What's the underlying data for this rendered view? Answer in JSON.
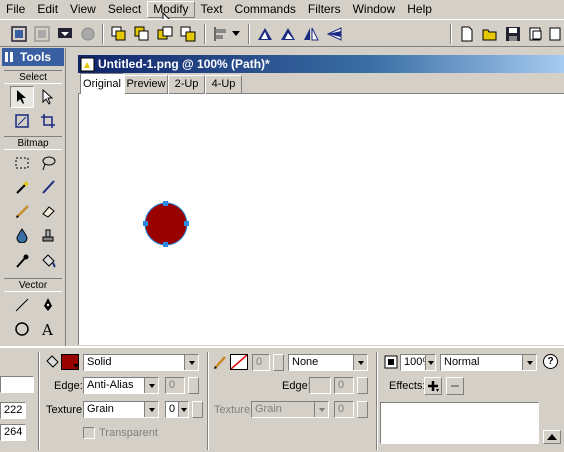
{
  "menubar": {
    "items": [
      {
        "label": "File",
        "active": false
      },
      {
        "label": "Edit",
        "active": false
      },
      {
        "label": "View",
        "active": false
      },
      {
        "label": "Select",
        "active": false
      },
      {
        "label": "Modify",
        "active": true
      },
      {
        "label": "Text",
        "active": false
      },
      {
        "label": "Commands",
        "active": false
      },
      {
        "label": "Filters",
        "active": false
      },
      {
        "label": "Window",
        "active": false
      },
      {
        "label": "Help",
        "active": false
      }
    ]
  },
  "tools": {
    "title": "Tools",
    "section_select": "Select",
    "section_bitmap": "Bitmap",
    "section_vector": "Vector"
  },
  "document": {
    "title": "Untitled-1.png @ 100% (Path)*",
    "tabs": [
      {
        "label": "Original",
        "active": true
      },
      {
        "label": "Preview",
        "active": false
      },
      {
        "label": "2-Up",
        "active": false
      },
      {
        "label": "4-Up",
        "active": false
      }
    ],
    "circle_color": "#990000",
    "handle_color": "#2b8be0"
  },
  "properties": {
    "left_field_1": "",
    "x_value": "222",
    "y_value": "264",
    "fill_color": "#990000",
    "fill_type": "Solid",
    "edge_label": "Edge:",
    "edge_value": "Anti-Alias",
    "edge_amount": "0",
    "texture_label": "Texture:",
    "texture_value": "Grain",
    "texture_amount": "0",
    "transparent_label": "Transparent",
    "stroke_size": "0",
    "stroke_type": "None",
    "stroke_edge_label": "Edge:",
    "stroke_edge_amount": "0",
    "stroke_texture_label": "Texture:",
    "stroke_texture_value": "Grain",
    "stroke_texture_amount": "0",
    "opacity": "100%",
    "blend_mode": "Normal",
    "effects_label": "Effects:",
    "help_icon_label": "?"
  }
}
